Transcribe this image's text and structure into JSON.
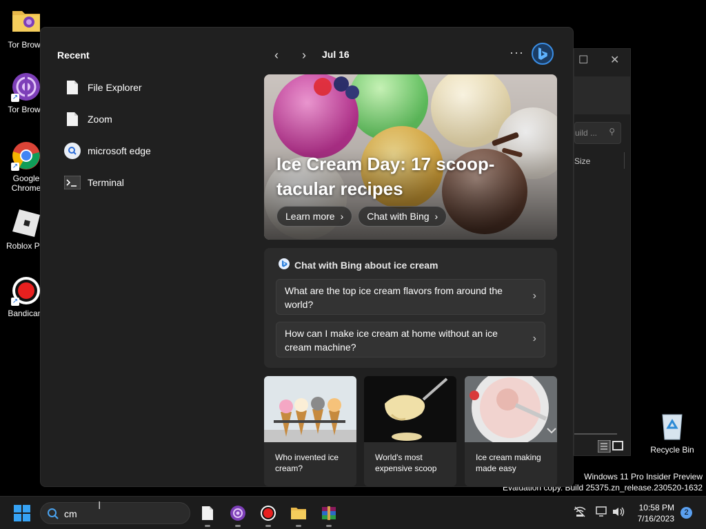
{
  "desktop": {
    "icons": [
      {
        "label": "Tor Brows"
      },
      {
        "label": "Tor Brows"
      },
      {
        "label": "Google Chrome"
      },
      {
        "label": "Roblox Pla"
      },
      {
        "label": "Bandicam"
      }
    ],
    "recycle_bin": "Recycle Bin",
    "watermark_line1": "Windows 11 Pro Insider Preview",
    "watermark_line2": "Evaluation copy. Build 25375.zn_release.230520-1632"
  },
  "background_window": {
    "search_placeholder": "uild ...",
    "column_size": "Size"
  },
  "panel": {
    "recent_title": "Recent",
    "recent_items": [
      {
        "label": "File Explorer",
        "icon": "document-icon"
      },
      {
        "label": "Zoom",
        "icon": "document-icon"
      },
      {
        "label": "microsoft edge",
        "icon": "search-icon"
      },
      {
        "label": "Terminal",
        "icon": "terminal-icon"
      }
    ],
    "date": "Jul 16",
    "hero": {
      "title": "Ice Cream Day: 17 scoop-tacular recipes",
      "learn_more": "Learn more",
      "chat_with_bing": "Chat with Bing"
    },
    "chat": {
      "heading": "Chat with Bing about ice cream",
      "questions": [
        "What are the top ice cream flavors from around the world?",
        "How can I make ice cream at home without an ice cream machine?"
      ]
    },
    "cards": [
      {
        "label": "Who invented ice cream?"
      },
      {
        "label": "World's most expensive scoop"
      },
      {
        "label": "Ice cream making made easy"
      }
    ]
  },
  "taskbar": {
    "search_value": "cm",
    "time": "10:58 PM",
    "date": "7/16/2023",
    "notification_count": "2"
  },
  "colors": {
    "accent": "#36a3f5",
    "panel_bg": "#202020",
    "card_bg": "#2b2b2b"
  }
}
